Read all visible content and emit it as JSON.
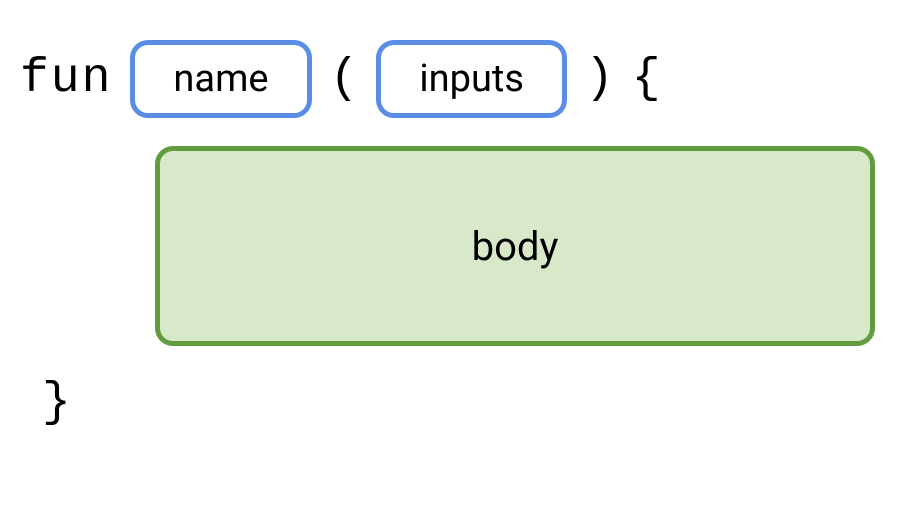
{
  "syntax": {
    "keyword": "fun",
    "name_placeholder": "name",
    "open_paren": "(",
    "inputs_placeholder": "inputs",
    "close_paren": ")",
    "open_brace": "{",
    "body_placeholder": "body",
    "close_brace": "}"
  }
}
